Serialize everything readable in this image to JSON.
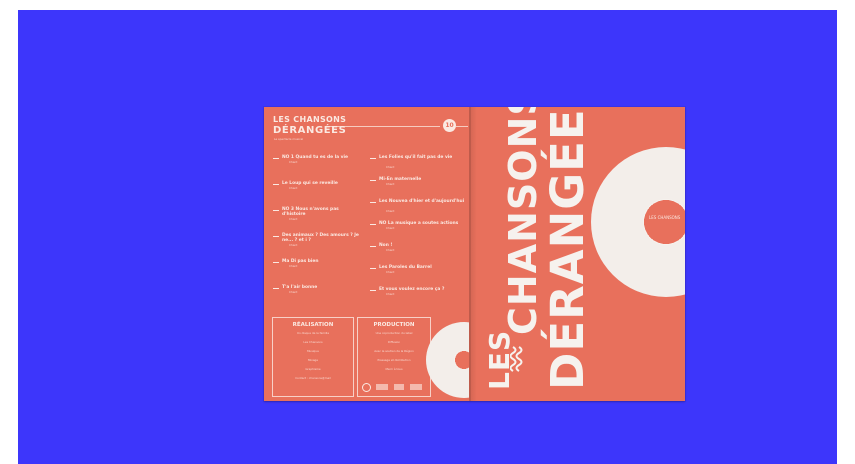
{
  "back_cover": {
    "logo_line1": "LES CHANSONS",
    "logo_line2": "DÉRANGÉES",
    "logo_tagline": "Le spectacle musical",
    "badge": "10"
  },
  "tracks_left": [
    {
      "title": "NO 1 Quand tu es de la vie",
      "sub": "Chant"
    },
    {
      "title": "Le Loup qui se reveille",
      "sub": "Chant"
    },
    {
      "title": "NO 3 Nous n'avons pas d'histoire",
      "sub": "Chant"
    },
    {
      "title": "Des animaux ? Des amours ? Je ne... ? et i ?",
      "sub": "Chant"
    },
    {
      "title": "Ma Di pas bien",
      "sub": "Chant"
    },
    {
      "title": "T'a l'air bonne",
      "sub": "Chant"
    }
  ],
  "tracks_right": [
    {
      "title": "Les Folies qu'il fait pas de vie",
      "sub": "Chant"
    },
    {
      "title": "Mi-En maternelle",
      "sub": "Chant"
    },
    {
      "title": "Les Nouvea d'hier et d'aujourd'hui",
      "sub": "Chant"
    },
    {
      "title": "NO La musique a soutes actions",
      "sub": "Chant"
    },
    {
      "title": "Non !",
      "sub": "Chant"
    },
    {
      "title": "Les Paroles du Barrel",
      "sub": "Chant"
    },
    {
      "title": "Et vous voulez encore ça ?",
      "sub": "Chant"
    }
  ],
  "box_realisation": {
    "title": "RÉALISATION",
    "lines": [
      "Un disque de la famille",
      "Les Chansons",
      "Musique",
      "Mixage",
      "Graphisme",
      "Contact : chansons@mail"
    ]
  },
  "box_production": {
    "title": "PRODUCTION",
    "lines": [
      "Une coproduction du label",
      "Diffusion",
      "Avec le soutien de la Région",
      "Pressage et distribution",
      "Merci à tous"
    ]
  },
  "front_cover": {
    "word1": "LES",
    "word2": "CHANSONS",
    "word3": "DÉRANGÉES",
    "record_label": "LES CHANSONS"
  },
  "colors": {
    "background": "#3d36fb",
    "cover": "#e8705c",
    "ink": "#f6f2ee"
  }
}
